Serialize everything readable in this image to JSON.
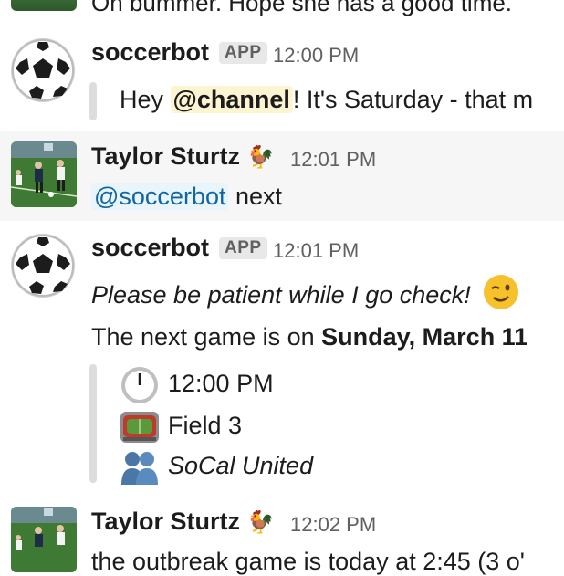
{
  "top_message": {
    "text": "Oh bummer. Hope she has a good time."
  },
  "messages": [
    {
      "author": "soccerbot",
      "badge": "APP",
      "time": "12:00 PM",
      "quote": {
        "prefix": "Hey ",
        "mention": "@channel",
        "suffix": "! It's Saturday - that m"
      }
    },
    {
      "author": "Taylor Sturtz",
      "time": "12:01 PM",
      "mention": "@soccerbot",
      "suffix": " next"
    },
    {
      "author": "soccerbot",
      "badge": "APP",
      "time": "12:01 PM",
      "italic_line": "Please be patient while I go check!",
      "next_line_prefix": "The next game is on ",
      "next_line_bold": "Sunday, March 11",
      "details": [
        {
          "icon": "clock-icon",
          "text": "12:00 PM",
          "italic": false
        },
        {
          "icon": "stadium-icon",
          "text": "Field 3",
          "italic": false
        },
        {
          "icon": "people-icon",
          "text": "SoCal United",
          "italic": true
        }
      ]
    },
    {
      "author": "Taylor Sturtz",
      "time": "12:02 PM",
      "partial_text": "the outbreak game is today at 2:45 (3 o'"
    }
  ]
}
